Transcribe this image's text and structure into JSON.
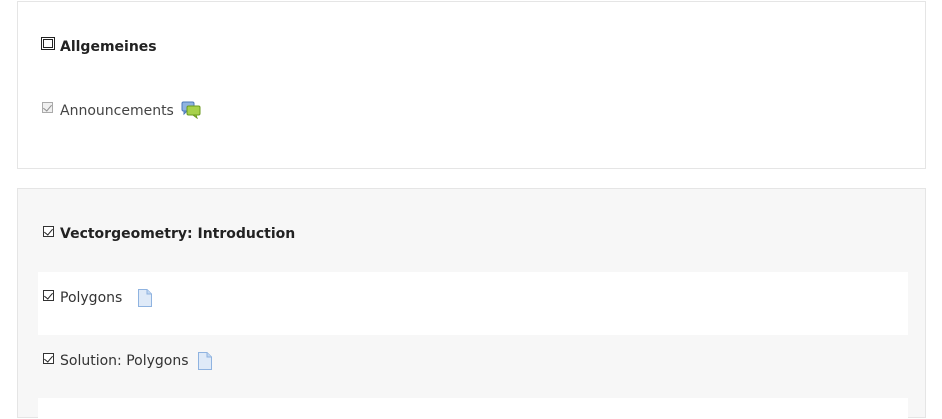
{
  "sections": [
    {
      "title": "Allgemeines",
      "items": [
        {
          "label": "Announcements",
          "icon": "forum-icon",
          "checked": true,
          "disabled": true
        }
      ]
    },
    {
      "title": "Vectorgeometry: Introduction",
      "checked": true,
      "items": [
        {
          "label": "Polygons",
          "icon": "file-icon",
          "checked": true
        },
        {
          "label": "Solution: Polygons",
          "icon": "file-icon",
          "checked": true
        }
      ]
    }
  ]
}
